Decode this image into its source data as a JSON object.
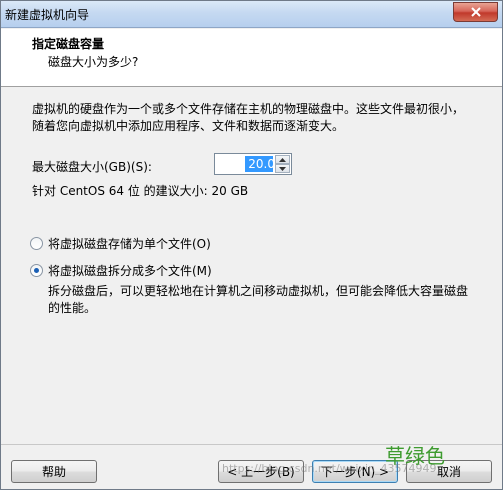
{
  "window": {
    "title": "新建虚拟机向导"
  },
  "header": {
    "title": "指定磁盘容量",
    "subtitle": "磁盘大小为多少?"
  },
  "content": {
    "description": "虚拟机的硬盘作为一个或多个文件存储在主机的物理磁盘中。这些文件最初很小，随着您向虚拟机中添加应用程序、文件和数据而逐渐变大。",
    "size_label": "最大磁盘大小(GB)(S):",
    "size_value": "20.0",
    "recommendation": "针对 CentOS 64 位 的建议大小: 20 GB",
    "radio_single": "将虚拟磁盘存储为单个文件(O)",
    "radio_split": "将虚拟磁盘拆分成多个文件(M)",
    "split_description": "拆分磁盘后，可以更轻松地在计算机之间移动虚拟机，但可能会降低大容量磁盘的性能。",
    "selected_option": "split"
  },
  "footer": {
    "help": "帮助",
    "back": "< 上一步(B)",
    "next": "下一步(N) >",
    "cancel": "取消"
  },
  "watermark": {
    "text": "草绿色",
    "url": "https://blog.csdn.net/weixin_43574949"
  },
  "colors": {
    "title_bar": "#c5d9f1",
    "close_button": "#c1392b",
    "selection": "#3399ff",
    "watermark": "#3e9b2f"
  }
}
